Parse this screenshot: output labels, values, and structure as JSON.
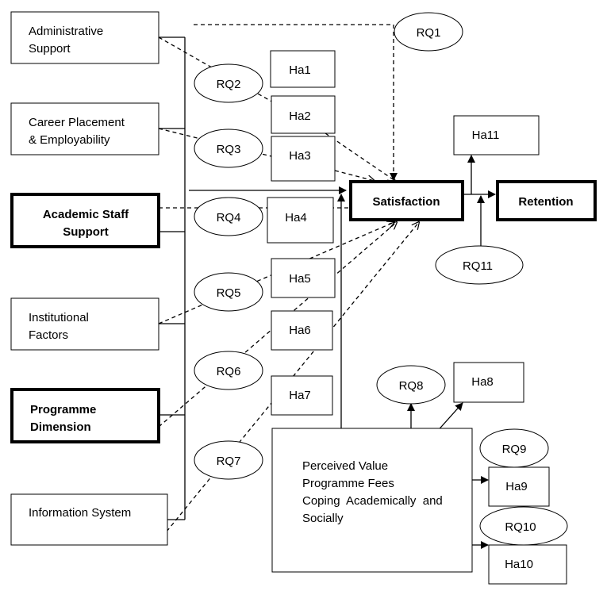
{
  "diagram": {
    "factors": [
      {
        "id": "admin",
        "lines": [
          "Administrative",
          "Support"
        ],
        "bold": false
      },
      {
        "id": "career",
        "lines": [
          "Career Placement",
          "& Employability"
        ],
        "bold": false
      },
      {
        "id": "academic",
        "lines": [
          "Academic Staff",
          "Support"
        ],
        "bold": true
      },
      {
        "id": "institutional",
        "lines": [
          "Institutional",
          "Factors"
        ],
        "bold": false
      },
      {
        "id": "programme",
        "lines": [
          "Programme",
          "Dimension"
        ],
        "bold": true
      },
      {
        "id": "info",
        "lines": [
          "Information System"
        ],
        "bold": false
      }
    ],
    "research_questions": [
      "RQ1",
      "RQ2",
      "RQ3",
      "RQ4",
      "RQ5",
      "RQ6",
      "RQ7",
      "RQ8",
      "RQ9",
      "RQ10",
      "RQ11"
    ],
    "hypotheses": [
      "Ha1",
      "Ha2",
      "Ha3",
      "Ha4",
      "Ha5",
      "Ha6",
      "Ha7",
      "Ha8",
      "Ha9",
      "Ha10",
      "Ha11"
    ],
    "satisfaction": "Satisfaction",
    "retention": "Retention",
    "mediators": [
      "Perceived Value",
      "Programme Fees",
      "Coping  Academically  and",
      "Socially"
    ]
  }
}
